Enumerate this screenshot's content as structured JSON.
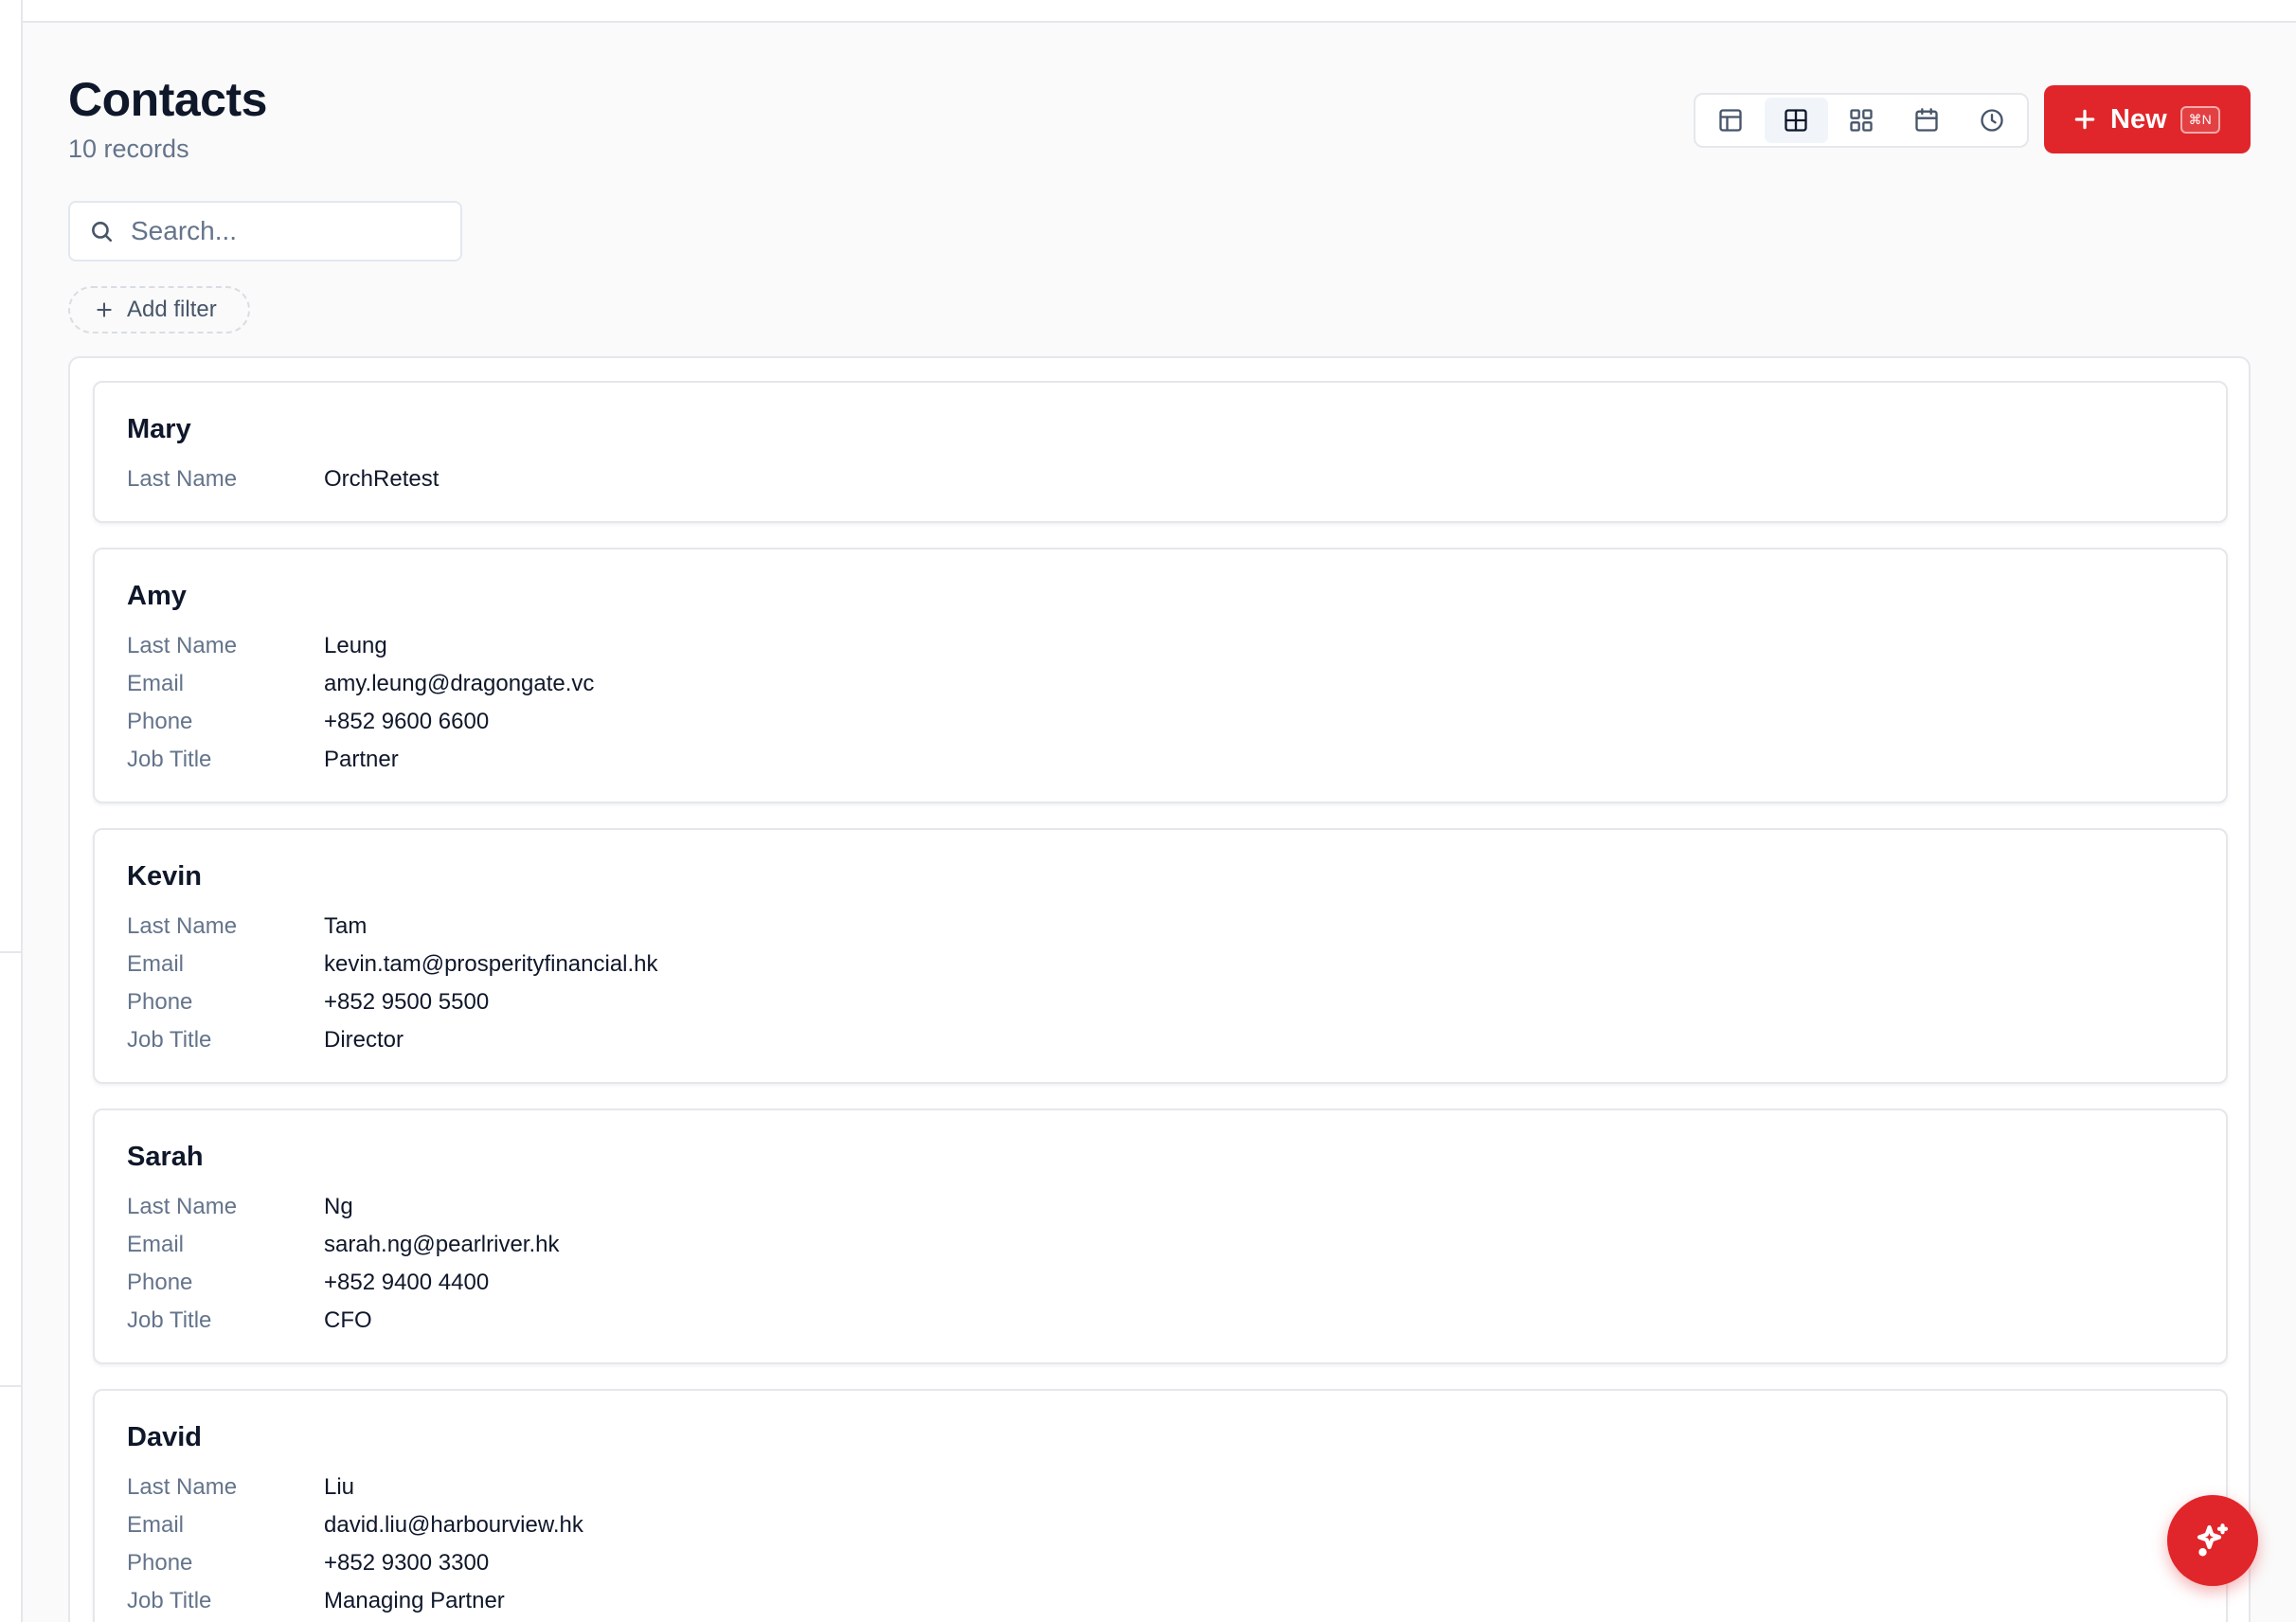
{
  "page": {
    "title": "Contacts",
    "record_count": "10 records"
  },
  "views": [
    {
      "icon": "table-icon",
      "active": false
    },
    {
      "icon": "board-icon",
      "active": true
    },
    {
      "icon": "gallery-icon",
      "active": false
    },
    {
      "icon": "calendar-icon",
      "active": false
    },
    {
      "icon": "timeline-icon",
      "active": false
    }
  ],
  "new_button": {
    "label": "New",
    "shortcut": "⌘N",
    "color": "#e0262a"
  },
  "search": {
    "placeholder": "Search...",
    "value": ""
  },
  "filter": {
    "add_label": "Add filter"
  },
  "contacts": [
    {
      "first_name": "Mary",
      "fields": [
        {
          "label": "Last Name",
          "value": "OrchRetest"
        }
      ]
    },
    {
      "first_name": "Amy",
      "fields": [
        {
          "label": "Last Name",
          "value": "Leung"
        },
        {
          "label": "Email",
          "value": "amy.leung@dragongate.vc"
        },
        {
          "label": "Phone",
          "value": "+852 9600 6600"
        },
        {
          "label": "Job Title",
          "value": "Partner"
        }
      ]
    },
    {
      "first_name": "Kevin",
      "fields": [
        {
          "label": "Last Name",
          "value": "Tam"
        },
        {
          "label": "Email",
          "value": "kevin.tam@prosperityfinancial.hk"
        },
        {
          "label": "Phone",
          "value": "+852 9500 5500"
        },
        {
          "label": "Job Title",
          "value": "Director"
        }
      ]
    },
    {
      "first_name": "Sarah",
      "fields": [
        {
          "label": "Last Name",
          "value": "Ng"
        },
        {
          "label": "Email",
          "value": "sarah.ng@pearlriver.hk"
        },
        {
          "label": "Phone",
          "value": "+852 9400 4400"
        },
        {
          "label": "Job Title",
          "value": "CFO"
        }
      ]
    },
    {
      "first_name": "David",
      "fields": [
        {
          "label": "Last Name",
          "value": "Liu"
        },
        {
          "label": "Email",
          "value": "david.liu@harbourview.hk"
        },
        {
          "label": "Phone",
          "value": "+852 9300 3300"
        },
        {
          "label": "Job Title",
          "value": "Managing Partner"
        }
      ]
    }
  ],
  "assistant": {
    "icon": "sparkles-icon"
  }
}
